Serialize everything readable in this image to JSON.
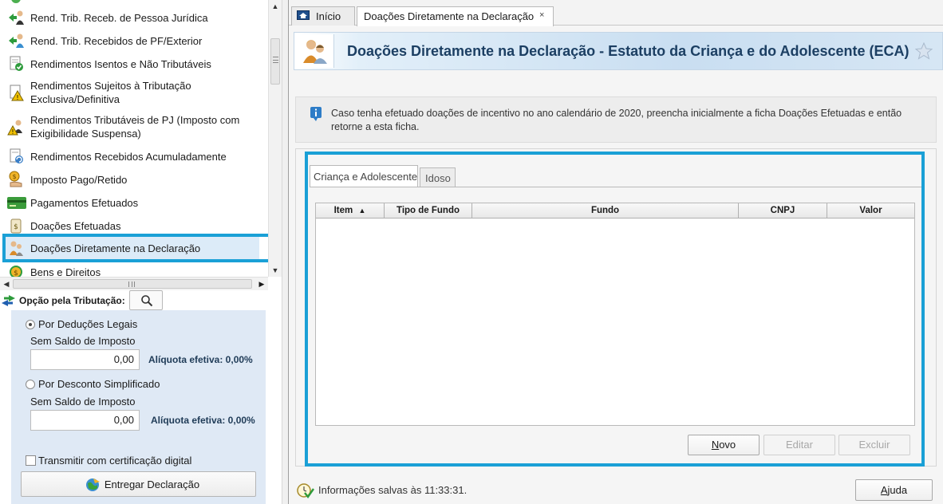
{
  "sidebar": {
    "items": [
      {
        "label": "Rend. Trib. Receb. de Pessoa Jurídica",
        "icon": "person-income-icon"
      },
      {
        "label": "Rend. Trib. Recebidos de PF/Exterior",
        "icon": "person-exterior-icon"
      },
      {
        "label": "Rendimentos Isentos e Não Tributáveis",
        "icon": "exempt-income-icon"
      },
      {
        "label": "Rendimentos Sujeitos à Tributação Exclusiva/Definitiva",
        "icon": "warning-document-icon"
      },
      {
        "label": "Rendimentos Tributáveis de PJ (Imposto com Exigibilidade Suspensa)",
        "icon": "suspended-tax-icon"
      },
      {
        "label": "Rendimentos Recebidos Acumuladamente",
        "icon": "accumulated-income-icon"
      },
      {
        "label": "Imposto Pago/Retido",
        "icon": "tax-paid-icon"
      },
      {
        "label": "Pagamentos Efetuados",
        "icon": "credit-card-icon"
      },
      {
        "label": "Doações Efetuadas",
        "icon": "donation-jar-icon"
      },
      {
        "label": "Doações Diretamente na Declaração",
        "icon": "family-icon"
      },
      {
        "label": "Bens e Direitos",
        "icon": "assets-coin-icon"
      }
    ]
  },
  "tax_option": {
    "title": "Opção pela Tributação:",
    "legal": {
      "radio_label": "Por Deduções Legais",
      "sub_label": "Sem Saldo de Imposto",
      "value": "0,00",
      "rate_label": "Alíquota efetiva: 0,00%",
      "selected": true
    },
    "simplified": {
      "radio_label": "Por Desconto Simplificado",
      "sub_label": "Sem Saldo de Imposto",
      "value": "0,00",
      "rate_label": "Alíquota efetiva: 0,00%",
      "selected": false
    },
    "cert_label": "Transmitir com certificação digital",
    "deliver_label": "Entregar Declaração"
  },
  "tabs": [
    {
      "label": "Início"
    },
    {
      "label": "Doações Diretamente na Declaração",
      "close": "×"
    }
  ],
  "header": {
    "title": "Doações Diretamente na Declaração - Estatuto da Criança e do Adolescente (ECA)"
  },
  "info": {
    "text": "Caso tenha efetuado doações de incentivo no ano calendário de 2020, preencha inicialmente a ficha Doações Efetuadas e então retorne a esta ficha."
  },
  "inner_tabs": [
    {
      "label": "Criança e Adolescente"
    },
    {
      "label": "Idoso"
    }
  ],
  "grid": {
    "columns": [
      "Item",
      "Tipo de Fundo",
      "Fundo",
      "CNPJ",
      "Valor"
    ],
    "sort_indicator": "▲"
  },
  "buttons": {
    "new_label": "ovo",
    "new_mnemonic": "N",
    "edit_label": "Editar",
    "delete_label": "Excluir",
    "help_label": "juda",
    "help_mnemonic": "A"
  },
  "status": {
    "text": "Informações salvas às 11:33:31."
  },
  "colors": {
    "highlight": "#1aa0d6",
    "title": "#1c3f63",
    "tax_box": "#dfe9f5"
  }
}
